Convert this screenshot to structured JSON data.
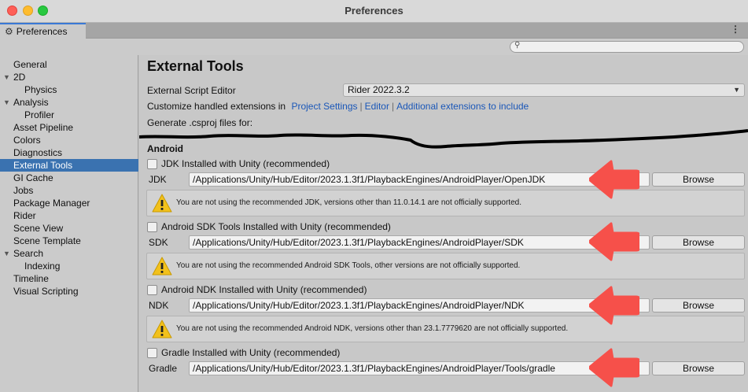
{
  "window": {
    "title": "Preferences"
  },
  "tab": {
    "label": "Preferences",
    "icon": "gear-icon",
    "menu_icon": "⋮"
  },
  "search": {
    "placeholder": ""
  },
  "sidebar": {
    "items": [
      {
        "label": "General",
        "indent": 0,
        "foldout": false,
        "selected": false
      },
      {
        "label": "2D",
        "indent": 0,
        "foldout": true,
        "selected": false
      },
      {
        "label": "Physics",
        "indent": 1,
        "foldout": false,
        "selected": false
      },
      {
        "label": "Analysis",
        "indent": 0,
        "foldout": true,
        "selected": false
      },
      {
        "label": "Profiler",
        "indent": 1,
        "foldout": false,
        "selected": false
      },
      {
        "label": "Asset Pipeline",
        "indent": 0,
        "foldout": false,
        "selected": false
      },
      {
        "label": "Colors",
        "indent": 0,
        "foldout": false,
        "selected": false
      },
      {
        "label": "Diagnostics",
        "indent": 0,
        "foldout": false,
        "selected": false
      },
      {
        "label": "External Tools",
        "indent": 0,
        "foldout": false,
        "selected": true
      },
      {
        "label": "GI Cache",
        "indent": 0,
        "foldout": false,
        "selected": false
      },
      {
        "label": "Jobs",
        "indent": 0,
        "foldout": false,
        "selected": false
      },
      {
        "label": "Package Manager",
        "indent": 0,
        "foldout": false,
        "selected": false
      },
      {
        "label": "Rider",
        "indent": 0,
        "foldout": false,
        "selected": false
      },
      {
        "label": "Scene View",
        "indent": 0,
        "foldout": false,
        "selected": false
      },
      {
        "label": "Scene Template",
        "indent": 0,
        "foldout": false,
        "selected": false
      },
      {
        "label": "Search",
        "indent": 0,
        "foldout": true,
        "selected": false
      },
      {
        "label": "Indexing",
        "indent": 1,
        "foldout": false,
        "selected": false
      },
      {
        "label": "Timeline",
        "indent": 0,
        "foldout": false,
        "selected": false
      },
      {
        "label": "Visual Scripting",
        "indent": 0,
        "foldout": false,
        "selected": false
      }
    ]
  },
  "main": {
    "title": "External Tools",
    "script_editor_label": "External Script Editor",
    "script_editor_value": "Rider 2022.3.2",
    "customize_label": "Customize handled extensions in",
    "links": [
      "Project Settings",
      "Editor",
      "Additional extensions to include"
    ],
    "link_separator": "|",
    "csproj_label": "Generate .csproj files for:",
    "android_heading": "Android",
    "browse_label": "Browse",
    "sections": [
      {
        "checkbox_label": "JDK Installed with Unity (recommended)",
        "field_label": "JDK",
        "path": "/Applications/Unity/Hub/Editor/2023.1.3f1/PlaybackEngines/AndroidPlayer/OpenJDK",
        "warning": "You are not using the recommended JDK, versions other than 11.0.14.1 are not officially supported.",
        "checked": false
      },
      {
        "checkbox_label": "Android SDK Tools Installed with Unity (recommended)",
        "field_label": "SDK",
        "path": "/Applications/Unity/Hub/Editor/2023.1.3f1/PlaybackEngines/AndroidPlayer/SDK",
        "warning": "You are not using the recommended Android SDK Tools, other versions are not officially supported.",
        "checked": false
      },
      {
        "checkbox_label": "Android NDK Installed with Unity (recommended)",
        "field_label": "NDK",
        "path": "/Applications/Unity/Hub/Editor/2023.1.3f1/PlaybackEngines/AndroidPlayer/NDK",
        "warning": "You are not using the recommended Android NDK, versions other than 23.1.7779620 are not officially supported.",
        "checked": false
      },
      {
        "checkbox_label": "Gradle Installed with Unity (recommended)",
        "field_label": "Gradle",
        "path": "/Applications/Unity/Hub/Editor/2023.1.3f1/PlaybackEngines/AndroidPlayer/Tools/gradle",
        "warning": "",
        "checked": false
      }
    ]
  },
  "colors": {
    "selection": "#3a72b0",
    "link": "#1a57b8",
    "arrow": "#f6504a",
    "warning_icon": "#f2c11c"
  }
}
